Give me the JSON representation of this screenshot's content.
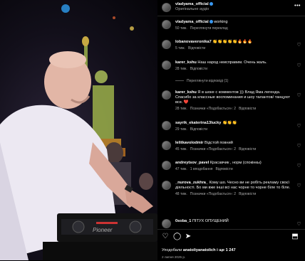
{
  "header": {
    "username": "vladyama_official",
    "audio": "Оригінальне аудіо",
    "more": "•••"
  },
  "caption": {
    "username": "vladyama_official",
    "text": "working",
    "time": "50 тиж.",
    "translate": "Переглянути переклад"
  },
  "comments": [
    {
      "username": "lobanovaveronika7",
      "text": "👏👏👏👏👏🔥🔥🔥",
      "time": "5 тиж.",
      "likes": "",
      "reply": "Відповісти",
      "view_replies": ""
    },
    {
      "username": "karer_kshu",
      "text": "Наш народ неисправим. Очень жаль.",
      "time": "28 тиж.",
      "likes": "",
      "reply": "Відповісти",
      "view_replies": "Переглянути відповіді (1)"
    },
    {
      "username": "karer_kshu",
      "text": "Я в шоке с комментов ))) Влад Яма легенда. Спасибо за классные воспоминания и шоу талантов/ танцуют все. ❤️",
      "time": "28 тиж.",
      "likes": "Позначки «Подобається»: 2",
      "reply": "Відповісти",
      "view_replies": ""
    },
    {
      "username": "sayrik_ekaterina13lucky",
      "text": "👏👏👏",
      "time": "29 тиж.",
      "likes": "",
      "reply": "Відповісти",
      "view_replies": ""
    },
    {
      "username": "lelitkavolodmir",
      "text": "Відстой повний",
      "time": "45 тиж.",
      "likes": "Позначки «Подобається»: 2",
      "reply": "Відповісти",
      "view_replies": ""
    },
    {
      "username": "andreytsov_pavel",
      "text": "Красавчик , норм (спокінкы)",
      "time": "47 тиж.",
      "likes": "1 вподобання",
      "reply": "Відповісти",
      "view_replies": ""
    },
    {
      "username": "_nurova_zukhra_",
      "text": "Кому шо. Чесно ви не робіть рекламу своєї діяльності. Бо ми вже інші всі нас чорне то чорне біле то біле.",
      "time": "48 тиж.",
      "likes": "Позначки «Подобається»: 2",
      "reply": "Відповісти",
      "view_replies": ""
    },
    {
      "username": "0soba_1",
      "text": "ПІТУХ ОПУЩЕНИЙ",
      "time": "",
      "likes": "",
      "reply": "",
      "view_replies": ""
    }
  ],
  "actions": {
    "likes_prefix": "Уподобали",
    "likes_user": "anatoliyanatolich",
    "likes_suffix": "і ще 1 247",
    "date": "2 липня 2025 р."
  },
  "icons": {
    "like": "heart-icon",
    "comment": "comment-icon",
    "share": "share-icon",
    "save": "bookmark-icon"
  },
  "colors": {
    "background": "#000000",
    "text": "#f5f5f5",
    "secondary": "#a8a8a8",
    "verified": "#3897f0"
  }
}
